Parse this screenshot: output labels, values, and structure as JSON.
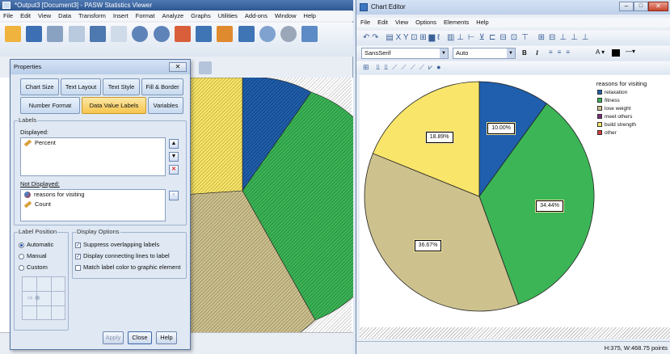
{
  "viewer": {
    "title": "*Output3 [Document3] - PASW Statistics Viewer",
    "menu": [
      "File",
      "Edit",
      "View",
      "Data",
      "Transform",
      "Insert",
      "Format",
      "Analyze",
      "Graphs",
      "Utilities",
      "Add-ons",
      "Window",
      "Help"
    ]
  },
  "properties": {
    "title": "Properties",
    "tabs_row1": [
      "Chart Size",
      "Text Layout",
      "Text Style",
      "Fill & Border"
    ],
    "tabs_row2": [
      "Number Format",
      "Data Value Labels",
      "Variables"
    ],
    "labels_group": "Labels",
    "displayed_label": "Displayed:",
    "displayed_items": [
      "Percent"
    ],
    "not_displayed_label": "Not Displayed:",
    "not_displayed_items": [
      "reasons for visiting",
      "Count"
    ],
    "label_position_group": "Label Position",
    "positions": [
      "Automatic",
      "Manual",
      "Custom"
    ],
    "position_selected": "Automatic",
    "display_options_group": "Display Options",
    "options": [
      {
        "label": "Suppress overlapping labels",
        "checked": true
      },
      {
        "label": "Display connecting lines to label",
        "checked": true
      },
      {
        "label": "Match label color to graphic element",
        "checked": false
      }
    ],
    "buttons": {
      "apply": "Apply",
      "close": "Close",
      "help": "Help"
    }
  },
  "editor": {
    "title": "Chart Editor",
    "menu": [
      "File",
      "Edit",
      "View",
      "Options",
      "Elements",
      "Help"
    ],
    "font": "SansSerif",
    "size": "Auto",
    "bold": "B",
    "italic": "I",
    "status": "H:375, W:468.75 points"
  },
  "colors": {
    "relaxation": "#1f5fad",
    "fitness": "#3bb556",
    "lose_weight": "#cdc18e",
    "meet_others": "#7a2e7a",
    "build_strength": "#f8e56a",
    "other": "#d93b3b"
  },
  "chart_data": {
    "type": "pie",
    "legend_title": "reasons for visiting",
    "legend_position": "top-right",
    "categories": [
      "relaxation",
      "fitness",
      "lose weight",
      "meet others",
      "build strength",
      "other"
    ],
    "values": [
      10.0,
      34.44,
      36.67,
      0,
      18.89,
      0
    ],
    "labels": [
      "10.00%",
      "34.44%",
      "36.67%",
      "",
      "18.89%",
      ""
    ]
  }
}
